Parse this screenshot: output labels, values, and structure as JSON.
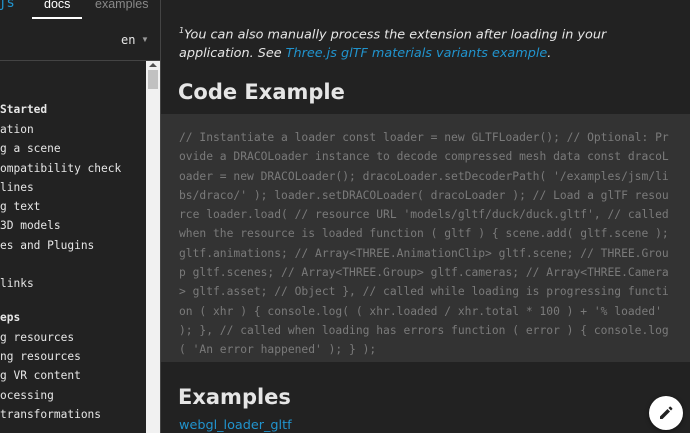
{
  "header": {
    "brand": "js",
    "tabs": [
      {
        "label": "docs",
        "active": true
      },
      {
        "label": "examples",
        "active": false
      }
    ],
    "language": "en"
  },
  "sidebar": {
    "items": [
      {
        "label": "Started",
        "heading": true
      },
      {
        "label": "ation",
        "heading": false
      },
      {
        "label": "g a scene",
        "heading": false
      },
      {
        "label": "ompatibility check",
        "heading": false
      },
      {
        "label": " lines",
        "heading": false
      },
      {
        "label": "g text",
        "heading": false
      },
      {
        "label": " 3D models",
        "heading": false
      },
      {
        "label": "es and Plugins",
        "heading": false
      },
      {
        "label": "links",
        "heading": false
      },
      {
        "label": "eps",
        "heading": true
      },
      {
        "label": "g resources",
        "heading": false
      },
      {
        "label": "ng resources",
        "heading": false
      },
      {
        "label": "g VR content",
        "heading": false
      },
      {
        "label": "ocessing",
        "heading": false
      },
      {
        "label": "transformations",
        "heading": false
      }
    ]
  },
  "main": {
    "footnote": {
      "marker": "1",
      "text": "You can also manually process the extension after loading in your application. See ",
      "link": "Three.js glTF materials variants example",
      "end": "."
    },
    "code_heading": "Code Example",
    "code": "// Instantiate a loader const loader = new GLTFLoader(); // Optional: Provide a DRACOLoader instance to decode compressed mesh data const dracoLoader = new DRACOLoader(); dracoLoader.setDecoderPath( '/examples/jsm/libs/draco/' ); loader.setDRACOLoader( dracoLoader ); // Load a glTF resource loader.load( // resource URL 'models/gltf/duck/duck.gltf', // called when the resource is loaded function ( gltf ) { scene.add( gltf.scene ); gltf.animations; // Array<THREE.AnimationClip> gltf.scene; // THREE.Group gltf.scenes; // Array<THREE.Group> gltf.cameras; // Array<THREE.Camera> gltf.asset; // Object }, // called while loading is progressing function ( xhr ) { console.log( ( xhr.loaded / xhr.total * 100 ) + '% loaded' ); }, // called when loading has errors function ( error ) { console.log( 'An error happened' ); } );",
    "examples_heading": "Examples",
    "example_link": "webgl_loader_gltf"
  },
  "colors": {
    "background": "#222222",
    "code_background": "#333333",
    "link": "#2194ce",
    "text": "#e6e6e6",
    "code_text": "#7a7a7a"
  },
  "icons": {
    "edit": "pencil-icon",
    "language_caret": "caret-down-icon",
    "scroll_up": "scroll-up-arrow-icon"
  }
}
